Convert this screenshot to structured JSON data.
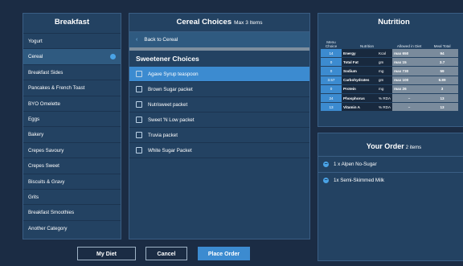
{
  "breakfast": {
    "title": "Breakfast",
    "items": [
      "Yogurt",
      "Cereal",
      "Breakfast Sides",
      "Pancakes & French Toast",
      "BYO Omelette",
      "Eggs",
      "Bakery",
      "Crepes Savoury",
      "Crepes Sweet",
      "Biscuits & Gravy",
      "Grits",
      "Breakfast Smoothies",
      "Another Category"
    ],
    "selected_index": 1
  },
  "cereal": {
    "title": "Cereal Choices",
    "subtitle": "Max 3 Items",
    "back_label": "Back to Cereal",
    "section_title": "Sweetener Choices",
    "options": [
      "Agave Syrup teaspoon",
      "Brown Sugar packet",
      "Nutrisweet packet",
      "Sweet 'N Low packet",
      "Truvia packet",
      "White Sugar Packet"
    ],
    "selected_index": 0
  },
  "nutrition": {
    "title": "Nutrition",
    "headers": {
      "menu_choice": "Menu Choice",
      "nutrition": "Nutrition",
      "allowed": "Allowed in Diet",
      "meal_total": "Meal Total"
    },
    "rows": [
      {
        "choice": "14",
        "name": "Energy",
        "unit": "Kcal",
        "allowed": "max 650",
        "total": "94"
      },
      {
        "choice": "0",
        "name": "Total Fat",
        "unit": "gm",
        "allowed": "max 15",
        "total": "3.7"
      },
      {
        "choice": "0",
        "name": "Sodium",
        "unit": "mg",
        "allowed": "max 730",
        "total": "59"
      },
      {
        "choice": "3.57",
        "name": "Carbohydrates",
        "unit": "gm",
        "allowed": "max 100",
        "total": "6.89"
      },
      {
        "choice": "0",
        "name": "Protein",
        "unit": "mg",
        "allowed": "max 26",
        "total": "3"
      },
      {
        "choice": "24",
        "name": "Phosphorus",
        "unit": "% RDA",
        "allowed": "–",
        "total": "13"
      },
      {
        "choice": "13",
        "name": "Vitamin A",
        "unit": "% RDA",
        "allowed": "–",
        "total": "13"
      }
    ]
  },
  "order": {
    "title": "Your Order",
    "count": "2 items",
    "items": [
      "1 x Alpen No-Sugar",
      "1x Semi-Skimmed Milk"
    ]
  },
  "buttons": {
    "my_diet": "My Diet",
    "cancel": "Cancel",
    "place_order": "Place Order"
  },
  "colors": {
    "background": "#1b2c44",
    "panel": "#234262",
    "accent": "#3c8bd0",
    "highlight_dot": "#4aa3e6"
  },
  "icons": {
    "back": "chevron-left-icon",
    "selected": "dot-icon",
    "remove": "minus-circle-icon",
    "add": "plus-circle-icon",
    "checkbox": "checkbox-icon"
  }
}
